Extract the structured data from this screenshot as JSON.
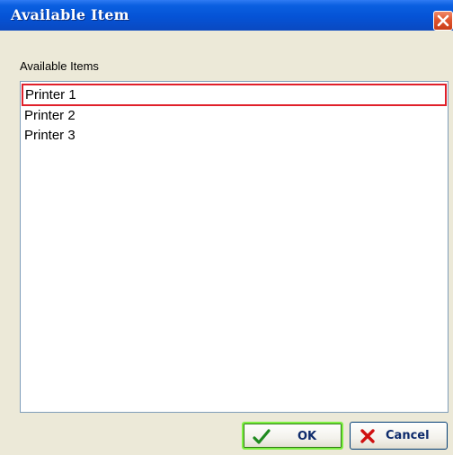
{
  "window": {
    "title": "Available Item"
  },
  "section_label": "Available Items",
  "list": {
    "items": [
      "Printer 1",
      "Printer 2",
      "Printer 3"
    ],
    "selected_index": 0
  },
  "buttons": {
    "ok_label": "OK",
    "cancel_label": "Cancel"
  },
  "icons": {
    "close": "close-icon",
    "ok": "checkmark-icon",
    "cancel": "x-icon"
  },
  "colors": {
    "titlebar": "#0553d6",
    "selection_outline": "#e0202a",
    "ok_focus": "#7ef043",
    "checkmark": "#1e8a1e",
    "cancel_x": "#d01010"
  }
}
